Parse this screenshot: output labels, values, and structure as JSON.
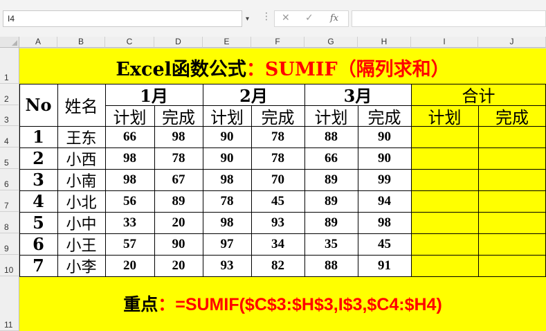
{
  "formula_bar": {
    "name_box": "I4",
    "dots": "⋮",
    "cancel_icon": "✕",
    "enter_icon": "✓",
    "fx_label": "fx",
    "formula": ""
  },
  "columns": [
    "A",
    "B",
    "C",
    "D",
    "E",
    "F",
    "G",
    "H",
    "I",
    "J"
  ],
  "rows": [
    "1",
    "2",
    "3",
    "4",
    "5",
    "6",
    "7",
    "8",
    "9",
    "10",
    "11"
  ],
  "title": {
    "part1": "Excel函数公式",
    "part2": "：SUMIF（隔列求和）"
  },
  "header": {
    "no": "No",
    "name": "姓名",
    "months": [
      "1月",
      "2月",
      "3月"
    ],
    "total": "合计",
    "plan": "计划",
    "done": "完成"
  },
  "records": [
    {
      "no": "1",
      "name": "王东",
      "values": [
        "66",
        "98",
        "90",
        "78",
        "88",
        "90"
      ]
    },
    {
      "no": "2",
      "name": "小西",
      "values": [
        "98",
        "78",
        "90",
        "78",
        "66",
        "90"
      ]
    },
    {
      "no": "3",
      "name": "小南",
      "values": [
        "98",
        "67",
        "98",
        "70",
        "89",
        "99"
      ]
    },
    {
      "no": "4",
      "name": "小北",
      "values": [
        "56",
        "89",
        "78",
        "45",
        "89",
        "94"
      ]
    },
    {
      "no": "5",
      "name": "小中",
      "values": [
        "33",
        "20",
        "98",
        "93",
        "89",
        "98"
      ]
    },
    {
      "no": "6",
      "name": "小王",
      "values": [
        "57",
        "90",
        "97",
        "34",
        "35",
        "45"
      ]
    },
    {
      "no": "7",
      "name": "小李",
      "values": [
        "20",
        "20",
        "93",
        "82",
        "88",
        "91"
      ]
    }
  ],
  "note": {
    "label": "重点",
    "formula": "：=SUMIF($C$3:$H$3,I$3,$C4:$H4)"
  },
  "colors": {
    "highlight": "#ffff00",
    "accent": "#ff0000"
  }
}
